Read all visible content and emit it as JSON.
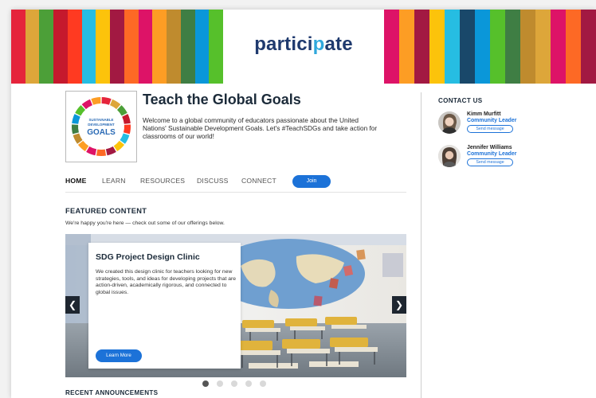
{
  "brand": {
    "logo_prefix": "partici",
    "logo_dot": "p",
    "logo_suffix": "ate"
  },
  "banner": {
    "left_stripes": [
      "#e5243b",
      "#dda63a",
      "#4c9f38",
      "#c5192d",
      "#ff3a21",
      "#26bde2",
      "#fcc30b",
      "#a21942",
      "#fd6925",
      "#dd1367",
      "#fd9d24",
      "#bf8b2e",
      "#3f7e44",
      "#0a97d9",
      "#56c02b"
    ],
    "right_stripes": [
      "#dd1367",
      "#fd9d24",
      "#a21942",
      "#fcc30b",
      "#26bde2",
      "#19486a",
      "#0a97d9",
      "#56c02b",
      "#3f7e44",
      "#bf8b2e",
      "#dda63a",
      "#dd1367",
      "#fd6925",
      "#a21942"
    ]
  },
  "group": {
    "title": "Teach the Global Goals",
    "description": "Welcome to a global community of educators passionate about the United Nations' Sustainable Development Goals. Let's #TeachSDGs and take action for classrooms of our world!",
    "logo_line1": "SUSTAINABLE",
    "logo_line2": "DEVELOPMENT",
    "logo_line3": "GOALS"
  },
  "nav": {
    "home": "HOME",
    "learn": "LEARN",
    "resources": "RESOURCES",
    "discuss": "DISCUSS",
    "connect": "CONNECT",
    "join": "Join"
  },
  "featured": {
    "heading": "FEATURED CONTENT",
    "subheading": "We're happy you're here — check out some of our offerings below.",
    "slide": {
      "title": "SDG Project Design Clinic",
      "text": "We created this design clinic for teachers looking for new strategies, tools, and ideas for developing projects that are action-driven, academically rigorous, and connected to global issues.",
      "button": "Learn More"
    },
    "slide_count": 5,
    "active_slide": 1
  },
  "announcements": {
    "heading": "RECENT ANNOUNCEMENTS"
  },
  "contact": {
    "heading": "CONTACT US",
    "people": [
      {
        "name": "Kimm Murfitt",
        "role": "Community Leader",
        "action": "Send message"
      },
      {
        "name": "Jennifer Williams",
        "role": "Community Leader",
        "action": "Send message"
      }
    ]
  },
  "colors": {
    "accent": "#1c72d8",
    "title": "#1c2b3a",
    "logo": "#1f3a6e"
  }
}
